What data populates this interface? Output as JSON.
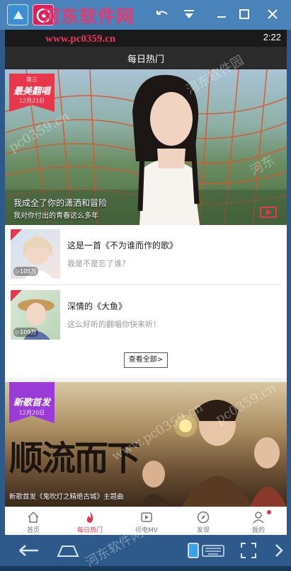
{
  "watermark": {
    "logo_text": "河东软件网",
    "url_text": "www.pc0359.cn",
    "diag_1": "pc0359.cn",
    "diag_2": "河东软件园",
    "diag_3": "pc0359.cn",
    "diag_4": "河东软件网",
    "diag_5": "www.pc0359.cn",
    "diag_6": "河东"
  },
  "status": {
    "time": "2:22"
  },
  "header": {
    "title": "每日热门"
  },
  "featured": {
    "badge_small": "第三",
    "badge_title": "最美翻唱",
    "badge_date": "12月21日",
    "title": "我成全了你的潇洒和冒险",
    "subtitle": "我对你付出的青春这么多年"
  },
  "songs": [
    {
      "title": "这是一首《不为谁而作的歌》",
      "subtitle": "我是不是忘了谁？",
      "plays": "105万"
    },
    {
      "title": "深情的《大鱼》",
      "subtitle": "这么好听的翻唱你快来听！",
      "plays": "109万"
    }
  ],
  "more_label": "查看全部>",
  "second_banner": {
    "badge_title": "新歌首发",
    "badge_date": "12月20日",
    "poster_title": "顺流而下",
    "caption": "新歌首发《鬼吹灯之精绝古城》主题曲"
  },
  "tabs": [
    {
      "label": "首页",
      "icon": "home-icon",
      "active": false
    },
    {
      "label": "每日热门",
      "icon": "flame-icon",
      "active": true
    },
    {
      "label": "视电MV",
      "icon": "mv-icon",
      "active": false
    },
    {
      "label": "发现",
      "icon": "compass-icon",
      "active": false
    },
    {
      "label": "我的",
      "icon": "user-icon",
      "active": false
    }
  ],
  "colors": {
    "accent": "#e8364b",
    "badge_purple": "#9a3bd9",
    "emulator_blue": "#4a83b9"
  }
}
